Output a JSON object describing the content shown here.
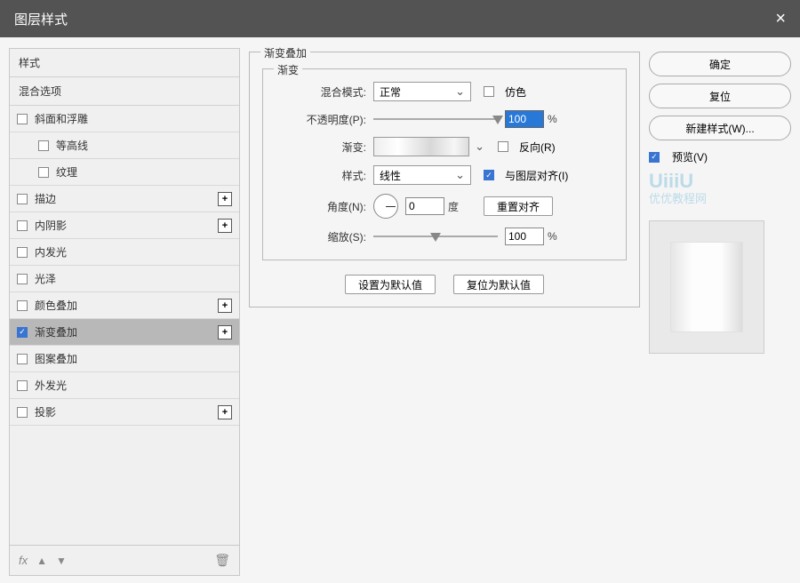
{
  "window": {
    "title": "图层样式",
    "close": "×"
  },
  "sidebar": {
    "styles_header": "样式",
    "blend_header": "混合选项",
    "items": [
      {
        "label": "斜面和浮雕",
        "checked": false,
        "has_plus": false,
        "indent": false
      },
      {
        "label": "等高线",
        "checked": false,
        "has_plus": false,
        "indent": true
      },
      {
        "label": "纹理",
        "checked": false,
        "has_plus": false,
        "indent": true
      },
      {
        "label": "描边",
        "checked": false,
        "has_plus": true,
        "indent": false
      },
      {
        "label": "内阴影",
        "checked": false,
        "has_plus": true,
        "indent": false
      },
      {
        "label": "内发光",
        "checked": false,
        "has_plus": false,
        "indent": false
      },
      {
        "label": "光泽",
        "checked": false,
        "has_plus": false,
        "indent": false
      },
      {
        "label": "颜色叠加",
        "checked": false,
        "has_plus": true,
        "indent": false
      },
      {
        "label": "渐变叠加",
        "checked": true,
        "has_plus": true,
        "indent": false,
        "selected": true
      },
      {
        "label": "图案叠加",
        "checked": false,
        "has_plus": false,
        "indent": false
      },
      {
        "label": "外发光",
        "checked": false,
        "has_plus": false,
        "indent": false
      },
      {
        "label": "投影",
        "checked": false,
        "has_plus": true,
        "indent": false
      }
    ],
    "footer": {
      "fx": "fx",
      "up": "▲",
      "down": "▼",
      "trash": "🗑"
    }
  },
  "panel": {
    "group_title": "渐变叠加",
    "subgroup_title": "渐变",
    "labels": {
      "blend_mode": "混合模式:",
      "opacity": "不透明度(P):",
      "gradient": "渐变:",
      "style": "样式:",
      "angle": "角度(N):",
      "scale": "缩放(S):",
      "degree": "度",
      "pct": "%"
    },
    "values": {
      "blend_mode": "正常",
      "dither": "仿色",
      "opacity": "100",
      "reverse": "反向(R)",
      "style": "线性",
      "align_layer": "与图层对齐(I)",
      "angle": "0",
      "reset_align": "重置对齐",
      "scale": "100"
    },
    "buttons": {
      "set_default": "设置为默认值",
      "reset_default": "复位为默认值"
    }
  },
  "right": {
    "ok": "确定",
    "reset": "复位",
    "new_style": "新建样式(W)...",
    "preview": "预览(V)",
    "watermark": "UiiiU",
    "watermark_sub": "优优教程网"
  }
}
